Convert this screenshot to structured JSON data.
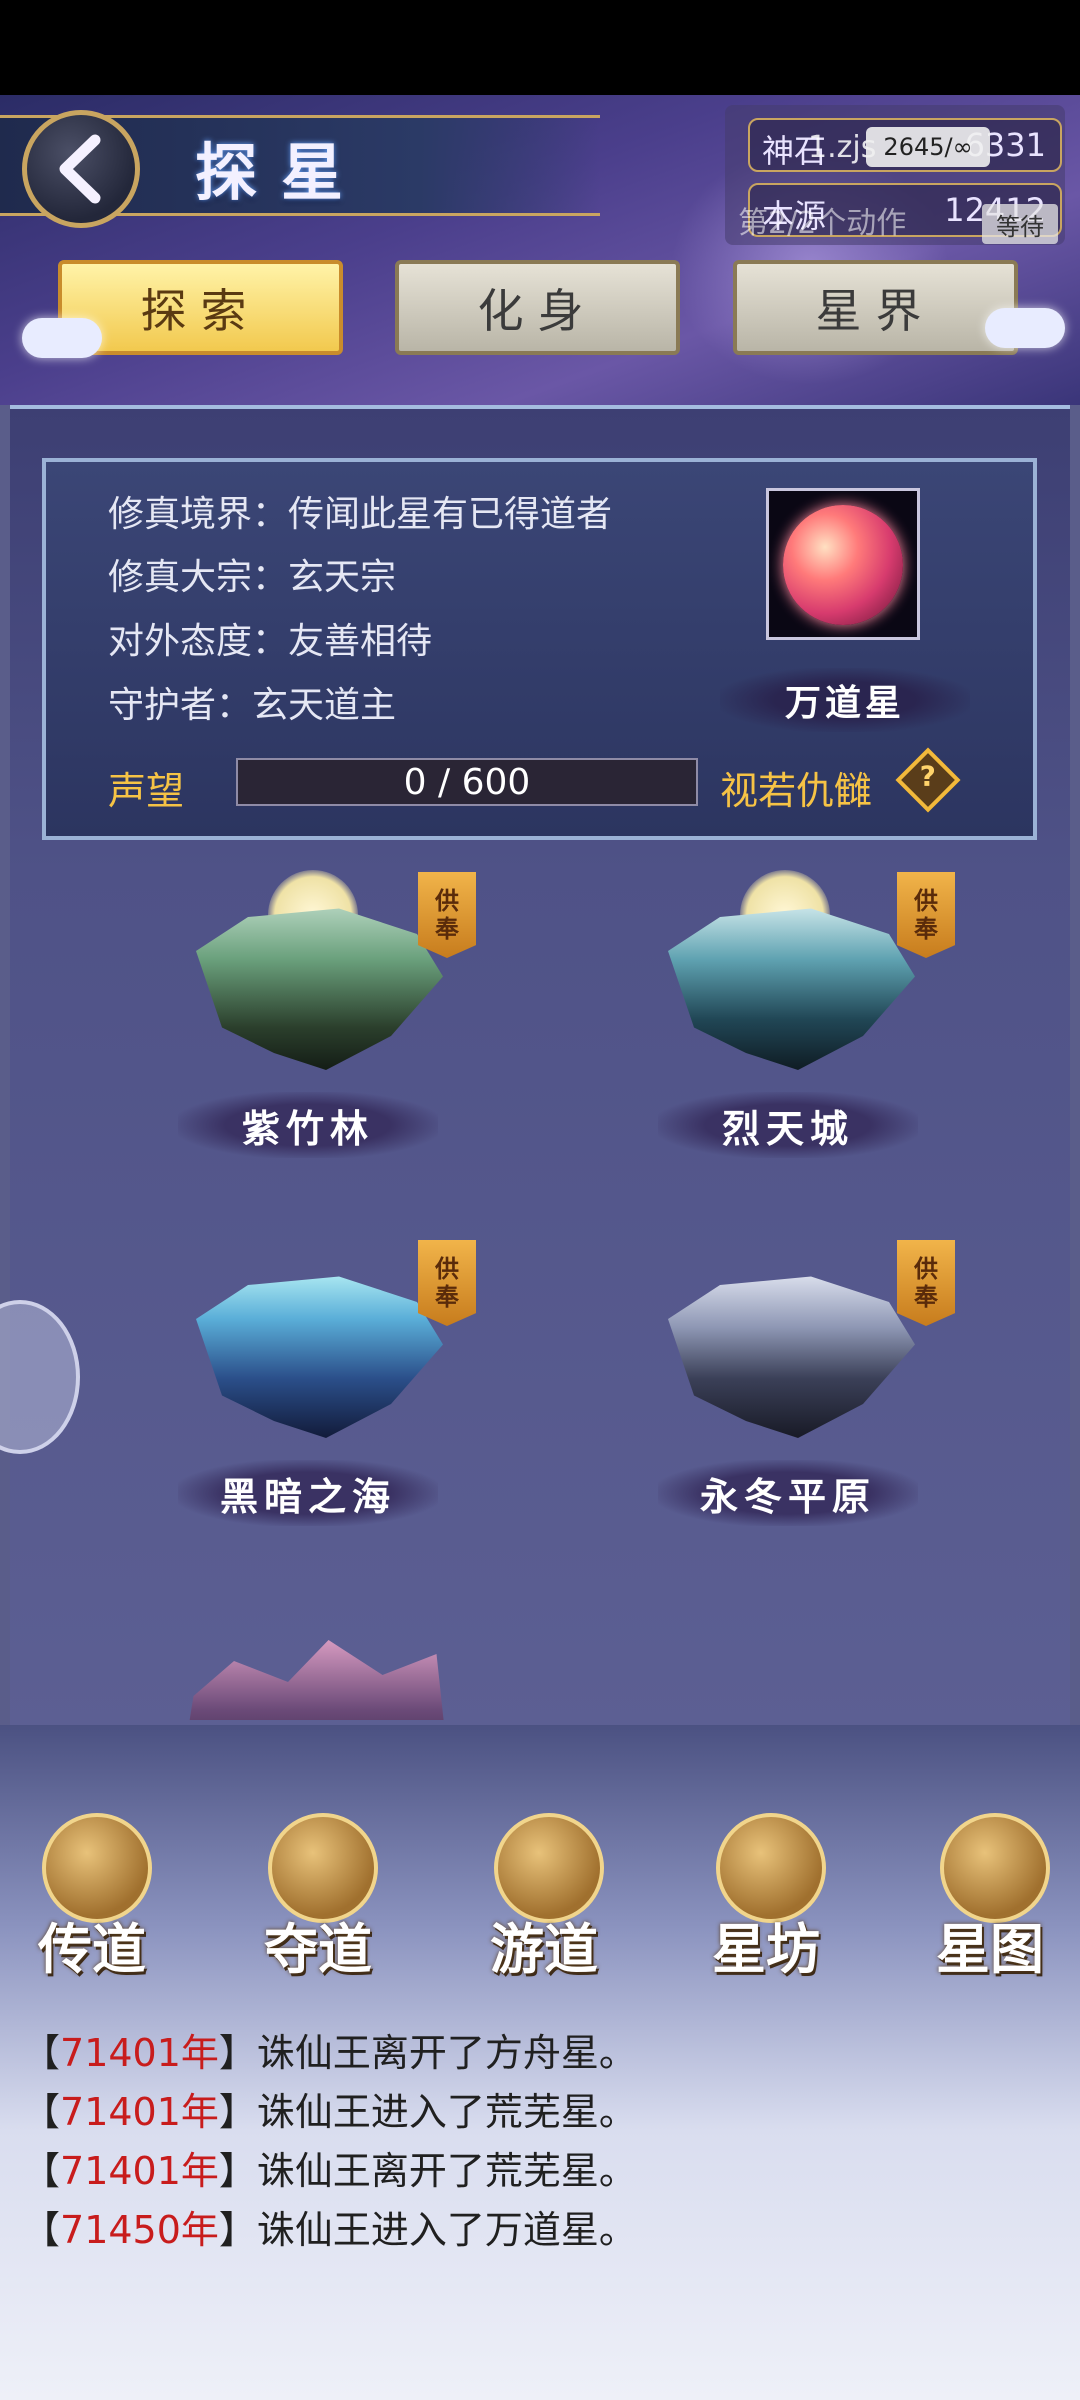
{
  "header": {
    "title": "探星",
    "resources": [
      {
        "label": "神石",
        "value": "6331"
      },
      {
        "label": "本源",
        "value": "12412"
      }
    ],
    "overlay": {
      "pill": "1.zjs",
      "pill_counter": "2645/∞",
      "action_text": "第2/2个动作",
      "wait_label": "等待"
    }
  },
  "tabs": [
    {
      "label": "探索",
      "active": true
    },
    {
      "label": "化身",
      "active": false
    },
    {
      "label": "星界",
      "active": false
    }
  ],
  "star_info": {
    "lines": [
      "修真境界：传闻此星有已得道者",
      "修真大宗：玄天宗",
      "对外态度：友善相待",
      "守护者：玄天道主"
    ],
    "planet_name": "万道星",
    "reputation_label": "声望",
    "reputation_text": "0 / 600",
    "reputation_fraction": 0,
    "attitude": "视若仇雠",
    "help_glyph": "?"
  },
  "regions": [
    {
      "name": "紫竹林",
      "tag": [
        "供",
        "奉"
      ]
    },
    {
      "name": "烈天城",
      "tag": [
        "供",
        "奉"
      ]
    },
    {
      "name": "黑暗之海",
      "tag": [
        "供",
        "奉"
      ]
    },
    {
      "name": "永冬平原",
      "tag": [
        "供",
        "奉"
      ]
    }
  ],
  "bottom_nav": [
    {
      "label": "传道",
      "icon": "swirl-emblem-icon"
    },
    {
      "label": "夺道",
      "icon": "planet-ring-icon"
    },
    {
      "label": "游道",
      "icon": "triskelion-icon"
    },
    {
      "label": "星坊",
      "icon": "constellation-icon"
    },
    {
      "label": "星图",
      "icon": "hexagram-icon"
    }
  ],
  "log": [
    {
      "year": "71401年",
      "text": "诛仙王离开了方舟星。"
    },
    {
      "year": "71401年",
      "text": "诛仙王进入了荒芜星。"
    },
    {
      "year": "71401年",
      "text": "诛仙王离开了荒芜星。"
    },
    {
      "year": "71450年",
      "text": "诛仙王进入了万道星。"
    }
  ],
  "colors": {
    "accent_gold": "#f6c345",
    "log_year_red": "#c81c1c",
    "active_tab": "#f2c94e"
  }
}
